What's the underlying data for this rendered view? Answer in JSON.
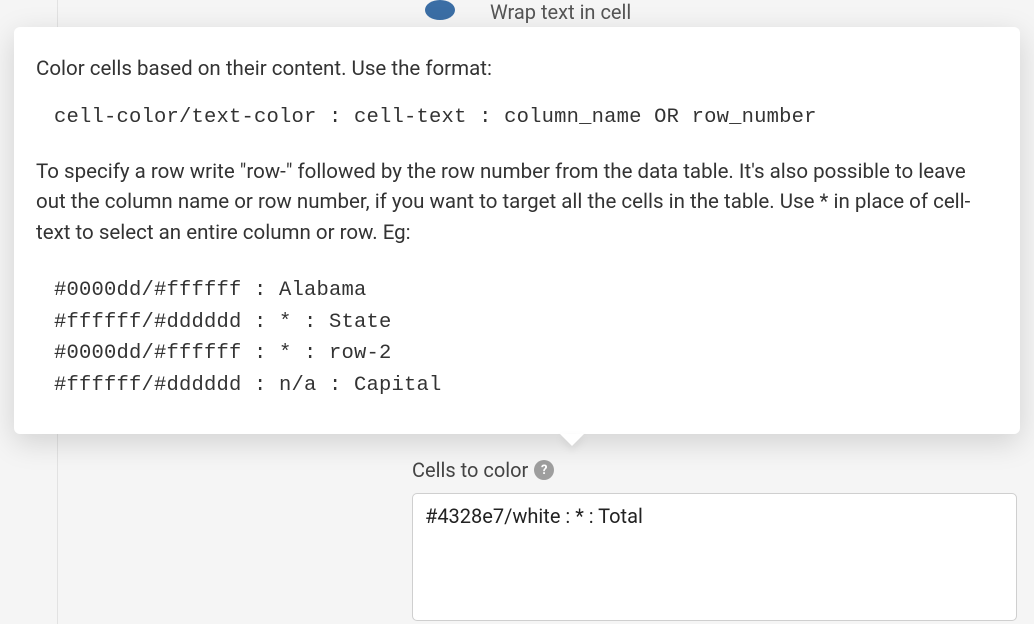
{
  "background": {
    "partial_top_text": "Wrap text in cell"
  },
  "tooltip": {
    "intro": "Color cells based on their content. Use the format:",
    "format_line": "cell-color/text-color : cell-text : column_name OR row_number",
    "description": "To specify a row write \"row-\" followed by the row number from the data table. It's also possible to leave out the column name or row number, if you want to target all the cells in the table. Use * in place of cell-text to select an entire column or row. Eg:",
    "examples": "#0000dd/#ffffff : Alabama\n#ffffff/#dddddd : * : State\n#0000dd/#ffffff : * : row-2\n#ffffff/#dddddd : n/a : Capital"
  },
  "field": {
    "label": "Cells to color",
    "help_icon_text": "?",
    "value": "#4328e7/white : * : Total"
  }
}
